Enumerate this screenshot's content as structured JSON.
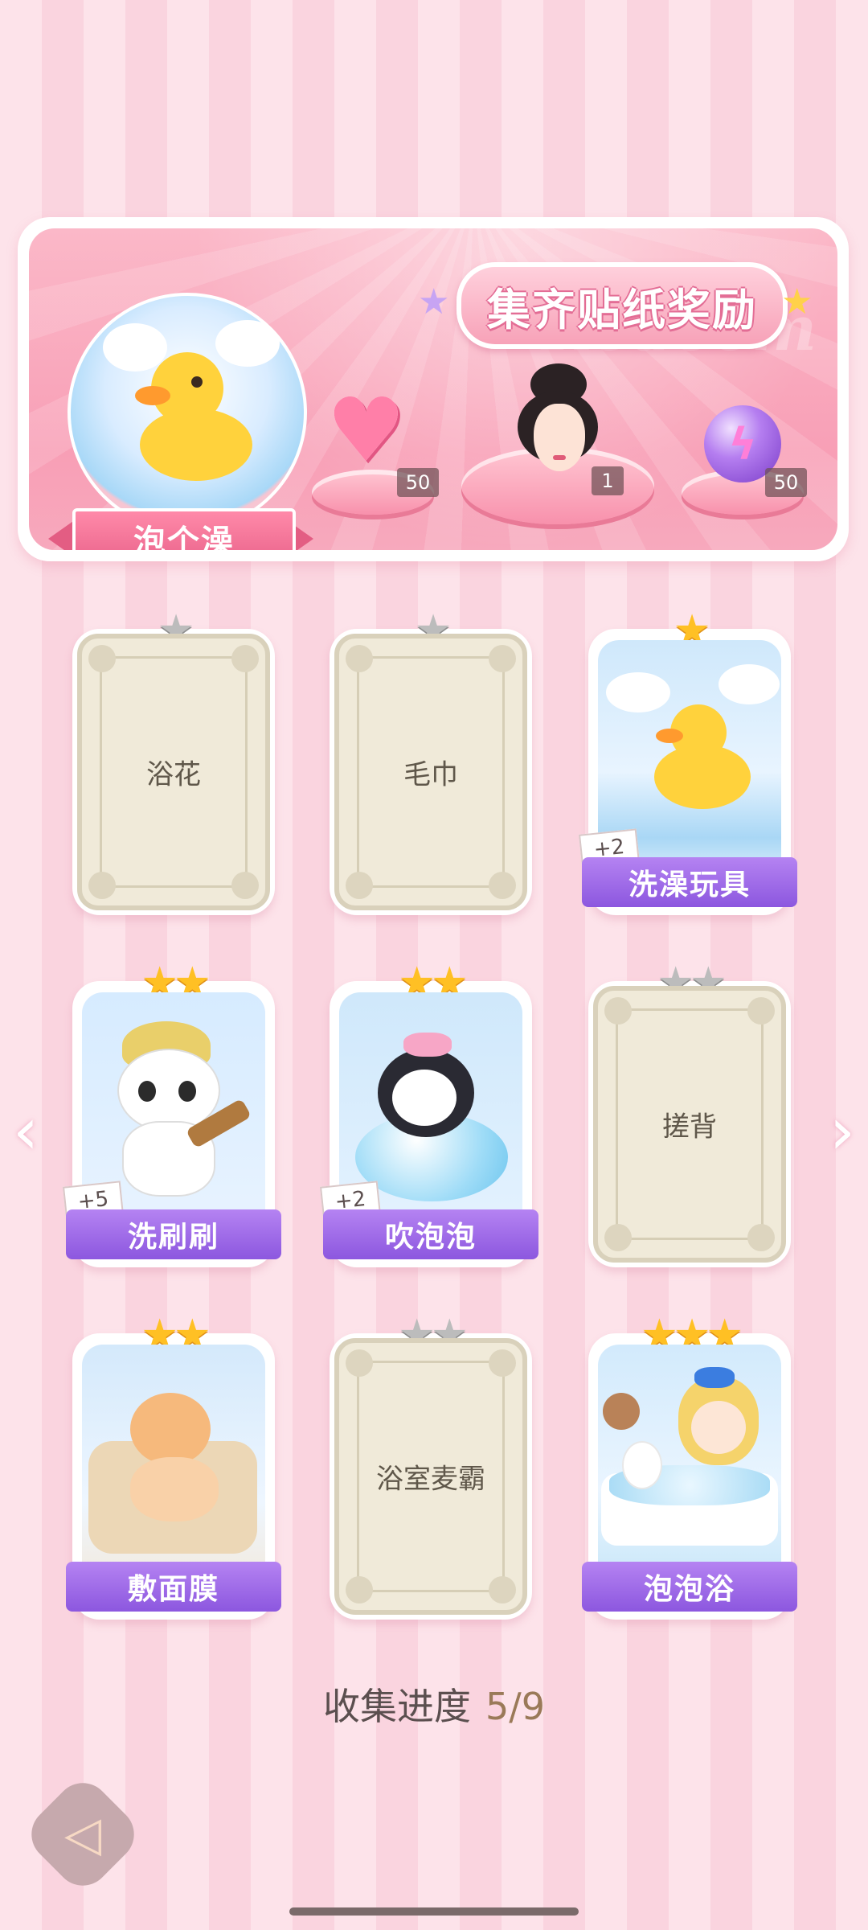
{
  "banner": {
    "title": "集齐贴纸奖励",
    "watermark": "Redeem",
    "theme_label": "泡个澡",
    "rewards": [
      {
        "icon": "pink-heart-gem-icon",
        "count": "50"
      },
      {
        "icon": "character-portrait",
        "count": "1"
      },
      {
        "icon": "purple-energy-orb-icon",
        "count": "50"
      }
    ]
  },
  "stickers": [
    {
      "name": "浴花",
      "stars": 1,
      "max_stars": 1,
      "collected": false,
      "bonus": ""
    },
    {
      "name": "毛巾",
      "stars": 1,
      "max_stars": 1,
      "collected": false,
      "bonus": ""
    },
    {
      "name": "洗澡玩具",
      "stars": 1,
      "max_stars": 1,
      "collected": true,
      "bonus": "+2"
    },
    {
      "name": "洗刷刷",
      "stars": 2,
      "max_stars": 2,
      "collected": true,
      "bonus": "+5"
    },
    {
      "name": "吹泡泡",
      "stars": 2,
      "max_stars": 2,
      "collected": true,
      "bonus": "+2"
    },
    {
      "name": "搓背",
      "stars": 2,
      "max_stars": 2,
      "collected": false,
      "bonus": ""
    },
    {
      "name": "敷面膜",
      "stars": 2,
      "max_stars": 2,
      "collected": true,
      "bonus": ""
    },
    {
      "name": "浴室麦霸",
      "stars": 2,
      "max_stars": 2,
      "collected": false,
      "bonus": ""
    },
    {
      "name": "泡泡浴",
      "stars": 3,
      "max_stars": 3,
      "collected": true,
      "bonus": ""
    }
  ],
  "progress": {
    "label": "收集进度",
    "value": "5/9",
    "collected": 5,
    "total": 9
  },
  "nav": {
    "prev_icon": "chevron-left-icon",
    "next_icon": "chevron-right-icon",
    "back_icon": "back-arrow-icon"
  },
  "colors": {
    "background": "#fde3ea",
    "label_purple": "#9a62e6",
    "star_gold": "#ffc024",
    "star_grey": "#bcbcbc"
  }
}
